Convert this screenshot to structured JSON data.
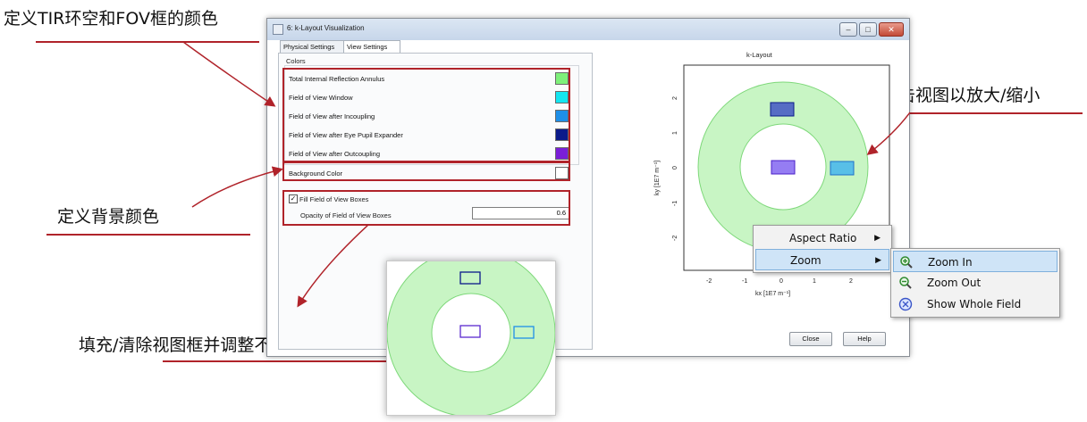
{
  "annotations": {
    "tir_fov": "定义TIR环空和FOV框的颜色",
    "zoom": "右键单击视图以放大/缩小",
    "background": "定义背景颜色",
    "fill": "填充/清除视图框并调整不透明度"
  },
  "window": {
    "title": "6: k-Layout Visualization",
    "minimize": "–",
    "maximize": "□",
    "close": "✕"
  },
  "tabs": [
    {
      "label": "Physical Settings",
      "active": false
    },
    {
      "label": "View Settings",
      "active": true
    }
  ],
  "colors_group": {
    "label": "Colors",
    "rows": [
      {
        "label": "Total Internal Reflection Annulus",
        "color": "#7ef07a"
      },
      {
        "label": "Field of View Window",
        "color": "#13e5f0"
      },
      {
        "label": "Field of View after Incoupling",
        "color": "#1e8fe8"
      },
      {
        "label": "Field of View after Eye Pupil Expander",
        "color": "#0b1a8a"
      },
      {
        "label": "Field of View after Outcoupling",
        "color": "#7a1ed8"
      }
    ],
    "background": {
      "label": "Background Color",
      "color": "#ffffff"
    }
  },
  "fill_group": {
    "checkbox_label": "Fill Field of View Boxes",
    "checked": true,
    "opacity_label": "Opacity of Field of View Boxes",
    "opacity_value": "0.6"
  },
  "plot": {
    "title": "k-Layout",
    "xlabel": "kx [1E7 m⁻¹]",
    "ylabel": "ky [1E7 m⁻¹]",
    "xticks": [
      "-2",
      "-1",
      "0",
      "1",
      "2"
    ],
    "yticks": [
      "2",
      "1",
      "0",
      "-1",
      "-2"
    ]
  },
  "buttons": {
    "close": "Close",
    "help": "Help"
  },
  "context_menu": {
    "items": [
      {
        "label": "Aspect Ratio",
        "arrow": "▶"
      },
      {
        "label": "Zoom",
        "arrow": "▶"
      }
    ],
    "submenu": [
      {
        "label": "Zoom In",
        "icon": "zoom-in-icon"
      },
      {
        "label": "Zoom Out",
        "icon": "zoom-out-icon"
      },
      {
        "label": "Show Whole Field",
        "icon": "show-whole-field-icon"
      }
    ]
  },
  "style": {
    "annotation_color": "#b0232a",
    "tir_annulus": "#c8f5c4",
    "menu_highlight": "#cfe4f7"
  }
}
